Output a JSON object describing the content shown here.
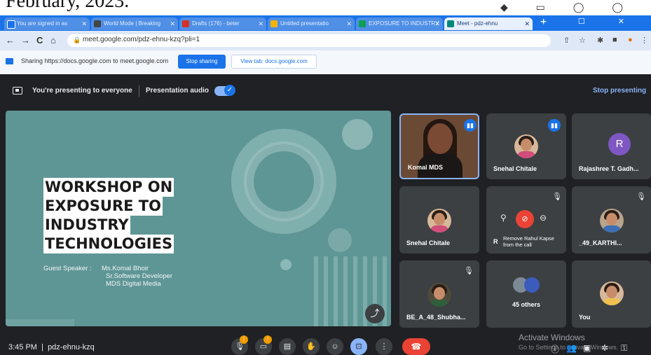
{
  "caption": "February, 2023.",
  "browser": {
    "tabs": [
      {
        "label": "You are signed in as",
        "color": "#1a73e8",
        "active": false
      },
      {
        "label": "World Mode | Breaking",
        "color": "#444444",
        "active": false
      },
      {
        "label": "Drafts (176) - beter",
        "color": "#d93025",
        "active": false
      },
      {
        "label": "Untitled presentatio",
        "color": "#f4b400",
        "active": false
      },
      {
        "label": "EXPOSURE TO INDUSTRY",
        "color": "#0f9d58",
        "active": false
      },
      {
        "label": "Meet - pdz-ehnu",
        "color": "#00897b",
        "active": true
      }
    ],
    "new_tab": "+",
    "window_controls": "– ☐ ✕",
    "nav": {
      "back": "←",
      "forward": "→",
      "reload": "C",
      "home": "⌂"
    },
    "url": "meet.google.com/pdz-ehnu-kzq?pli=1",
    "toolbar_icons": [
      "⇧",
      "☆",
      "✱",
      "■",
      "●",
      "⋮"
    ]
  },
  "share_bar": {
    "text": "Sharing https://docs.google.com to meet.google.com",
    "stop_label": "Stop sharing",
    "view_tab_label": "View tab: docs.google.com"
  },
  "meet": {
    "presenting_text": "You're presenting to everyone",
    "presentation_audio": "Presentation audio",
    "stop_presenting": "Stop presenting",
    "slide": {
      "title_lines": [
        "WORKSHOP ON",
        "EXPOSURE TO",
        "INDUSTRY",
        "TECHNOLOGIES"
      ],
      "guest_label": "Guest Speaker :",
      "guest_lines": [
        "Ms.Komal Bhoir",
        "Sr.Software Developer",
        "MDS Digital Media"
      ]
    },
    "tiles": [
      {
        "name": "Komal MDS"
      },
      {
        "name": "Snehal Chitale"
      },
      {
        "name": "Rajashree T. Gadh...",
        "initial": "R"
      },
      {
        "name": "Snehal Chitale"
      },
      {
        "name": "R"
      },
      {
        "name": "_49_KARTHI..."
      },
      {
        "name": "BE_A_48_Shubha..."
      },
      {
        "name": "45 others"
      },
      {
        "name": "You"
      }
    ],
    "hover_tooltip": "Remove Rahul Kapse from the call",
    "time": "3:45 PM",
    "meeting_code": "pdz-ehnu-kzq",
    "activate_line1": "Activate Windows",
    "activate_line2": "Go to Settings to activate Windows."
  }
}
